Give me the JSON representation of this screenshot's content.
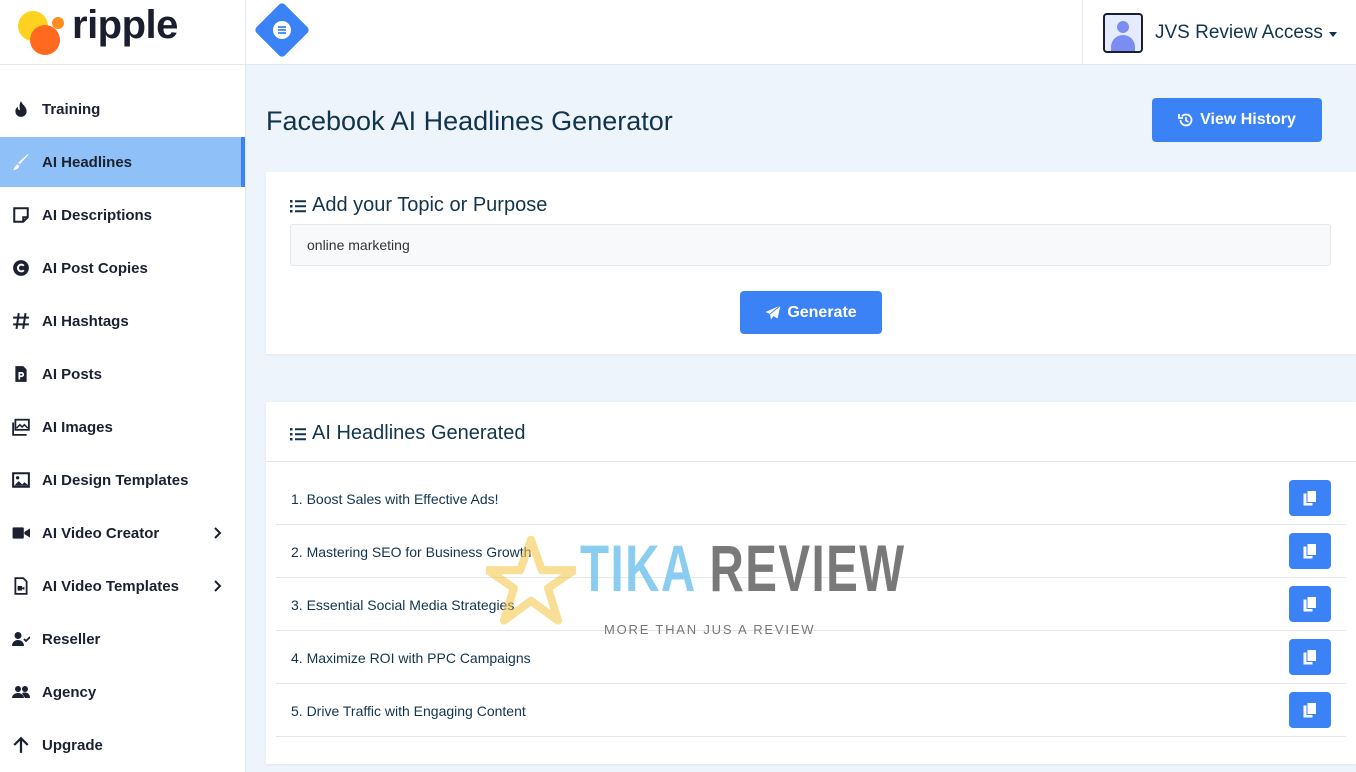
{
  "brand": {
    "name": "ripple"
  },
  "sidebar": {
    "items": [
      {
        "label": "Training",
        "icon": "fire-icon",
        "active": false
      },
      {
        "label": "AI Headlines",
        "icon": "brush-icon",
        "active": true
      },
      {
        "label": "AI Descriptions",
        "icon": "sticky-note-icon",
        "active": false
      },
      {
        "label": "AI Post Copies",
        "icon": "copyright-icon",
        "active": false
      },
      {
        "label": "AI Hashtags",
        "icon": "hashtag-icon",
        "active": false
      },
      {
        "label": "AI Posts",
        "icon": "file-p-icon",
        "active": false
      },
      {
        "label": "AI Images",
        "icon": "images-icon",
        "active": false
      },
      {
        "label": "AI Design Templates",
        "icon": "image-icon",
        "active": false
      },
      {
        "label": "AI Video Creator",
        "icon": "video-icon",
        "active": false,
        "has_submenu": true
      },
      {
        "label": "AI Video Templates",
        "icon": "file-video-icon",
        "active": false,
        "has_submenu": true
      },
      {
        "label": "Reseller",
        "icon": "user-check-icon",
        "active": false
      },
      {
        "label": "Agency",
        "icon": "users-icon",
        "active": false
      },
      {
        "label": "Upgrade",
        "icon": "arrow-up-icon",
        "active": false
      }
    ]
  },
  "header": {
    "user_name": "JVS Review Access"
  },
  "main": {
    "title": "Facebook AI Headlines Generator",
    "view_history_label": "View History",
    "topic_card": {
      "title": "Add your Topic or Purpose",
      "input_value": "online marketing",
      "generate_label": "Generate"
    },
    "results_card": {
      "title": "AI Headlines Generated",
      "headlines": [
        "1. Boost Sales with Effective Ads!",
        "2. Mastering SEO for Business Growth",
        "3. Essential Social Media Strategies",
        "4. Maximize ROI with PPC Campaigns",
        "5. Drive Traffic with Engaging Content"
      ]
    }
  },
  "watermark": {
    "title_part1": "TIKA",
    "title_part2": " REVIEW",
    "subtitle": "MORE THAN JUS A REVIEW"
  },
  "colors": {
    "accent": "#3b82f6",
    "active_nav": "#8fc0f7",
    "background": "#eef4fc",
    "text": "#12344d"
  }
}
